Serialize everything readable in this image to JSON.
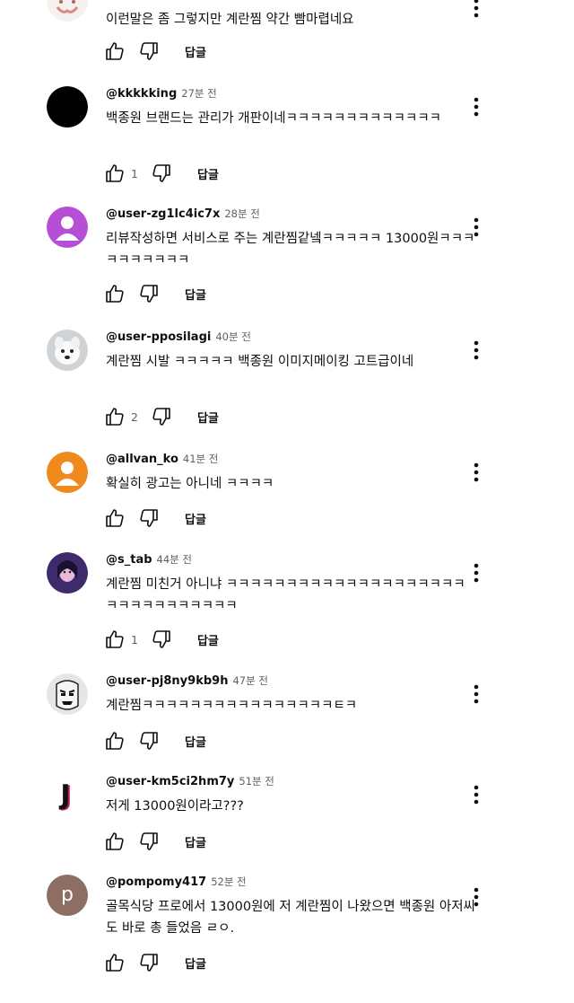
{
  "reply_label": "답글",
  "comments": [
    {
      "author": "",
      "time": "",
      "text": "이런말은 좀 그렇지만 계란찜 약간 빰마렵네요",
      "likes": "",
      "avatar": "partial-avatar"
    },
    {
      "author": "@kkkkking",
      "time": "27분 전",
      "text": "백종원 브랜드는 관리가 개판이네ㅋㅋㅋㅋㅋㅋㅋㅋㅋㅋㅋㅋㅋ",
      "likes": "1",
      "avatar": "black-circle"
    },
    {
      "author": "@user-zg1lc4ic7x",
      "time": "28분 전",
      "text": "리뷰작성하면 서비스로 주는 계란찜같넼ㅋㅋㅋㅋㅋ 13000원ㅋㅋㅋㅋㅋㅋㅋㅋㅋㅋ",
      "likes": "",
      "avatar": "purple-default",
      "avatar_color": "#b64fd6"
    },
    {
      "author": "@user-pposilagi",
      "time": "40분 전",
      "text": "계란찜 시발 ㅋㅋㅋㅋㅋ 백종원 이미지메이킹 고트급이네",
      "likes": "2",
      "avatar": "dog-photo"
    },
    {
      "author": "@allvan_ko",
      "time": "41분 전",
      "text": "확실히 광고는 아니네 ㅋㅋㅋㅋ",
      "likes": "",
      "avatar": "orange-default",
      "avatar_color": "#f08a1c"
    },
    {
      "author": "@s_tab",
      "time": "44분 전",
      "text": "계란찜 미친거 아니냐 ㅋㅋㅋㅋㅋㅋㅋㅋㅋㅋㅋㅋㅋㅋㅋㅋㅋㅋㅋㅋㅋㅋㅋㅋㅋㅋㅋㅋㅋㅋㅋ",
      "likes": "1",
      "avatar": "purple-photo"
    },
    {
      "author": "@user-pj8ny9kb9h",
      "time": "47분 전",
      "text": "계란찜ㅋㅋㅋㅋㅋㅋㅋㅋㅋㅋㅋㅋㅋㅋㅋㅋㅌㅋ",
      "likes": "",
      "avatar": "meme-face"
    },
    {
      "author": "@user-km5ci2hm7y",
      "time": "51분 전",
      "text": "저게 13000원이라고???",
      "likes": "",
      "avatar": "letter-j"
    },
    {
      "author": "@pompomy417",
      "time": "52분 전",
      "text": "골목식당 프로에서 13000원에 저 계란찜이 나왔으면 백종원 아저씨도 바로 총 들었음 ㄹㅇ.",
      "likes": "",
      "avatar": "letter-p",
      "avatar_letter": "p",
      "avatar_color": "#8d6e63"
    }
  ]
}
